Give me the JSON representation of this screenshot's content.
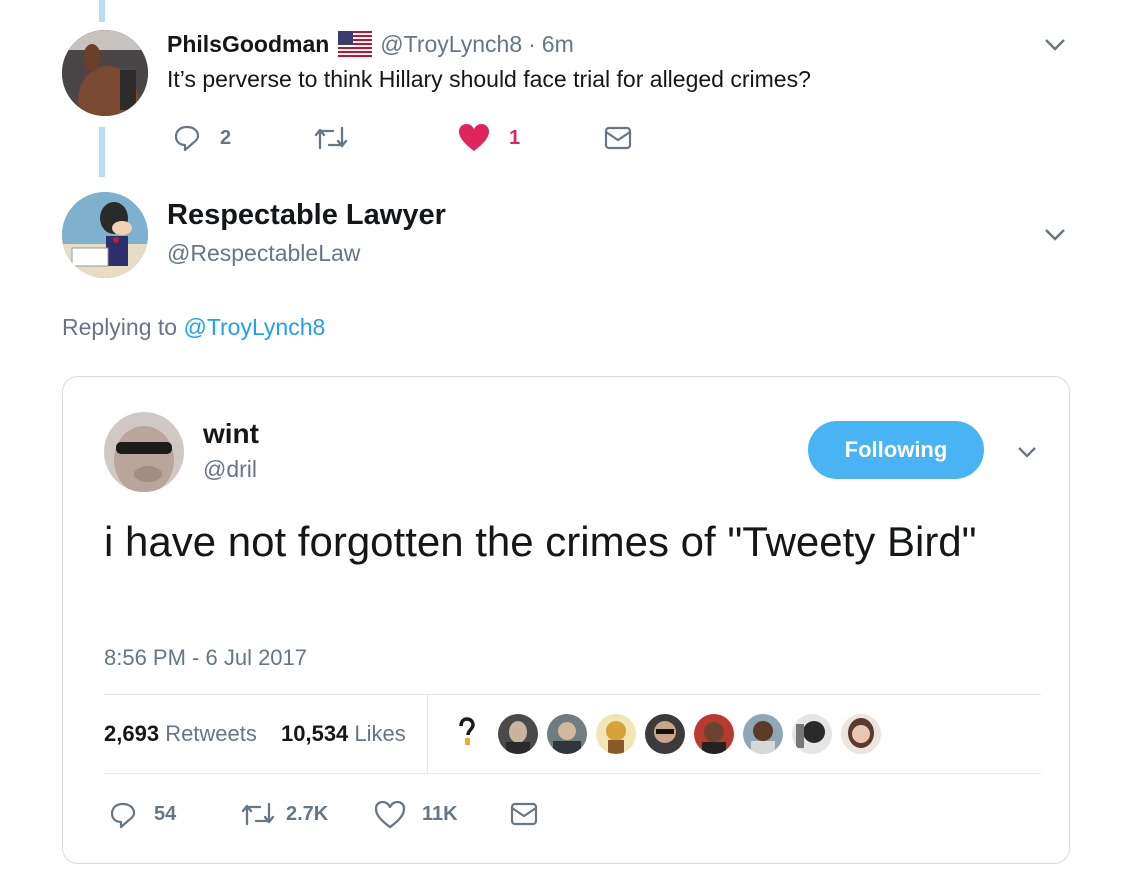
{
  "reply_tweet": {
    "display_name": "PhilsGoodman",
    "flag_icon": "us-flag-icon",
    "handle": "@TroyLynch8",
    "separator": "·",
    "time": "6m",
    "text": "It’s perverse to think Hillary should face trial for alleged crimes?",
    "reply_count": "2",
    "like_count": "1",
    "like_color": "#e0245e"
  },
  "main_tweet": {
    "display_name": "Respectable Lawyer",
    "handle": "@RespectableLaw",
    "replying_prefix": "Replying to",
    "replying_handle": "@TroyLynch8"
  },
  "quoted_tweet": {
    "display_name": "wint",
    "handle": "@dril",
    "follow_label": "Following",
    "text": "i have not forgotten the crimes of \"Tweety Bird\"",
    "timestamp": "8:56 PM - 6 Jul 2017",
    "retweets_count": "2,693",
    "retweets_label": "Retweets",
    "likes_count": "10,534",
    "likes_label": "Likes",
    "reply_count": "54",
    "retweet_count_short": "2.7K",
    "like_count_short": "11K"
  },
  "colors": {
    "accent": "#1da1f2",
    "follow_button": "#4ab3f4",
    "thread_line": "#b9dcf3",
    "muted_text": "#657786"
  }
}
